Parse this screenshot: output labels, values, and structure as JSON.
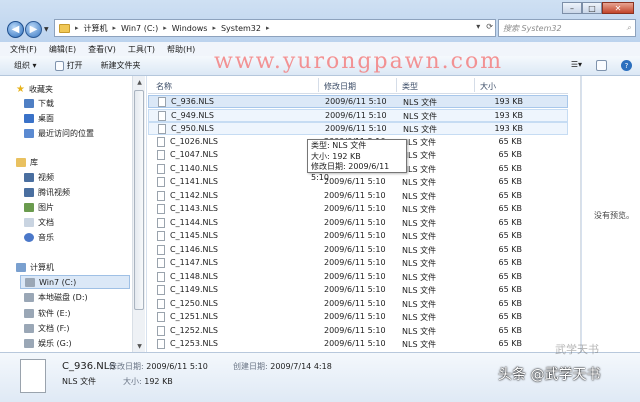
{
  "address": {
    "crumbs": [
      "计算机",
      "Win7 (C:)",
      "Windows",
      "System32"
    ],
    "search_placeholder": "搜索 System32"
  },
  "menu": [
    "文件(F)",
    "编辑(E)",
    "查看(V)",
    "工具(T)",
    "帮助(H)"
  ],
  "toolbar": {
    "organize": "组织 ▾",
    "open": "打开",
    "new_folder": "新建文件夹"
  },
  "watermark": "www.yurongpawn.com",
  "sidebar": {
    "items": [
      {
        "label": "收藏夹",
        "icon": "star-icon"
      },
      {
        "label": "下载",
        "icon": "download-folder-icon"
      },
      {
        "label": "桌面",
        "icon": "desktop-icon"
      },
      {
        "label": "最近访问的位置",
        "icon": "recent-places-icon"
      },
      {
        "label": "库",
        "icon": "library-icon"
      },
      {
        "label": "视频",
        "icon": "video-icon"
      },
      {
        "label": "腾讯视频",
        "icon": "video-icon"
      },
      {
        "label": "图片",
        "icon": "picture-icon"
      },
      {
        "label": "文档",
        "icon": "document-icon"
      },
      {
        "label": "音乐",
        "icon": "music-icon"
      },
      {
        "label": "计算机",
        "icon": "computer-icon"
      },
      {
        "label": "Win7 (C:)",
        "icon": "drive-icon"
      },
      {
        "label": "本地磁盘 (D:)",
        "icon": "drive-icon"
      },
      {
        "label": "软件 (E:)",
        "icon": "drive-icon"
      },
      {
        "label": "文档 (F:)",
        "icon": "drive-icon"
      },
      {
        "label": "娱乐 (G:)",
        "icon": "drive-icon"
      }
    ]
  },
  "columns": {
    "name": "名称",
    "date": "修改日期",
    "type": "类型",
    "size": "大小"
  },
  "files": [
    {
      "name": "C_936.NLS",
      "date": "2009/6/11 5:10",
      "type": "NLS 文件",
      "size": "193 KB"
    },
    {
      "name": "C_949.NLS",
      "date": "2009/6/11 5:10",
      "type": "NLS 文件",
      "size": "193 KB"
    },
    {
      "name": "C_950.NLS",
      "date": "2009/6/11 5:10",
      "type": "NLS 文件",
      "size": "193 KB"
    },
    {
      "name": "C_1026.NLS",
      "date": "2009/6/11 5:10",
      "type": "NLS 文件",
      "size": "65 KB"
    },
    {
      "name": "C_1047.NLS",
      "date": "2009/6/11 5:10",
      "type": "NLS 文件",
      "size": "65 KB"
    },
    {
      "name": "C_1140.NLS",
      "date": "2009/6/11 5:10",
      "type": "NLS 文件",
      "size": "65 KB"
    },
    {
      "name": "C_1141.NLS",
      "date": "2009/6/11 5:10",
      "type": "NLS 文件",
      "size": "65 KB"
    },
    {
      "name": "C_1142.NLS",
      "date": "2009/6/11 5:10",
      "type": "NLS 文件",
      "size": "65 KB"
    },
    {
      "name": "C_1143.NLS",
      "date": "2009/6/11 5:10",
      "type": "NLS 文件",
      "size": "65 KB"
    },
    {
      "name": "C_1144.NLS",
      "date": "2009/6/11 5:10",
      "type": "NLS 文件",
      "size": "65 KB"
    },
    {
      "name": "C_1145.NLS",
      "date": "2009/6/11 5:10",
      "type": "NLS 文件",
      "size": "65 KB"
    },
    {
      "name": "C_1146.NLS",
      "date": "2009/6/11 5:10",
      "type": "NLS 文件",
      "size": "65 KB"
    },
    {
      "name": "C_1147.NLS",
      "date": "2009/6/11 5:10",
      "type": "NLS 文件",
      "size": "65 KB"
    },
    {
      "name": "C_1148.NLS",
      "date": "2009/6/11 5:10",
      "type": "NLS 文件",
      "size": "65 KB"
    },
    {
      "name": "C_1149.NLS",
      "date": "2009/6/11 5:10",
      "type": "NLS 文件",
      "size": "65 KB"
    },
    {
      "name": "C_1250.NLS",
      "date": "2009/6/11 5:10",
      "type": "NLS 文件",
      "size": "65 KB"
    },
    {
      "name": "C_1251.NLS",
      "date": "2009/6/11 5:10",
      "type": "NLS 文件",
      "size": "65 KB"
    },
    {
      "name": "C_1252.NLS",
      "date": "2009/6/11 5:10",
      "type": "NLS 文件",
      "size": "65 KB"
    },
    {
      "name": "C_1253.NLS",
      "date": "2009/6/11 5:10",
      "type": "NLS 文件",
      "size": "65 KB"
    }
  ],
  "tooltip": {
    "type": "类型: NLS 文件",
    "size": "大小: 192 KB",
    "date": "修改日期: 2009/6/11 5:10"
  },
  "preview": "没有预览。",
  "details": {
    "name": "C_936.NLS",
    "type": "NLS 文件",
    "modified_label": "修改日期:",
    "modified": "2009/6/11 5:10",
    "size_label": "大小:",
    "size": "192 KB",
    "created_label": "创建日期:",
    "created": "2009/7/14 4:18"
  },
  "brand": "头条 @武学天书",
  "brand_faint": "武学天书",
  "colors": {
    "selection": "#dbe8f7",
    "watermark": "#f47a7a",
    "accent": "#2c6fbe"
  }
}
